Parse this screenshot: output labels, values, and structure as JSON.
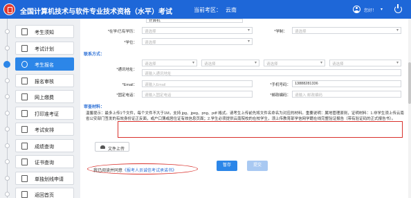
{
  "header": {
    "title": "全国计算机技术与软件专业技术资格（水平）考试",
    "region_label": "当前考区：",
    "region_value": "云南",
    "user_name": "您好！"
  },
  "sidebar": {
    "items": [
      {
        "label": "考生须知",
        "icon": "doc-icon"
      },
      {
        "label": "考试计划",
        "icon": "list-icon"
      },
      {
        "label": "考生报名",
        "icon": "clock-icon",
        "active": true
      },
      {
        "label": "报名审核",
        "icon": "review-icon"
      },
      {
        "label": "网上缴费",
        "icon": "card-icon"
      },
      {
        "label": "打印准考证",
        "icon": "printer-icon"
      },
      {
        "label": "考试安排",
        "icon": "schedule-icon"
      },
      {
        "label": "成绩查询",
        "icon": "search-icon"
      },
      {
        "label": "证书查询",
        "icon": "certificate-icon"
      },
      {
        "label": "单独划线申请",
        "icon": "apply-icon"
      },
      {
        "label": "返回首页",
        "icon": "home-icon"
      }
    ]
  },
  "form": {
    "top_field_value": "计算机",
    "education_label": "*在学/已有学历：",
    "education_value": "请选择",
    "degree_label": "*学制：",
    "degree_value": "请选择",
    "xuewei_label": "*学位：",
    "xuewei_value": "请选择",
    "contact_section": "联系方式：",
    "address_label": "*通讯地址：",
    "address_selects": [
      "请选择",
      "请选择",
      "请选择",
      "请选择"
    ],
    "address_placeholder": "请输入通讯地址",
    "email_label": "*Email：",
    "email_placeholder": "请输入Email",
    "mobile_label": "*手机号码：",
    "mobile_value": "13888281336",
    "phone_label": "*固定电话：",
    "phone_placeholder": "请输入固定电话",
    "postcode_label": "*邮政编码：",
    "postcode_placeholder": "请输入 邮政编码",
    "materials_section": "审查材料："
  },
  "notice": {
    "text": "温馨提示：最多上传1个文件，每个文件不大于1M，支持 jpg、jpeg、png、pdf 格式。请考生上传前先将文件名命名为对应的材料。重要说明：属地管理原则，证明材料：1.非学生须上传云南省公安部门签发的有效身份证正反面，或户口簿或居住证有效信息页面；2.学生必须提供云南院校的在校学生，须上传教育部学信网学籍在线完整验证报告（带有验证码的正式报告书）。"
  },
  "upload": {
    "label": "文件上传"
  },
  "agreement": {
    "prefix": "我已阅读并同意",
    "link": "《报考人员诚信考试承诺书》"
  },
  "buttons": {
    "save": "暂存",
    "submit": "提交"
  },
  "colors": {
    "header": "#1e67d8",
    "accent": "#2c86e8",
    "highlight": "#d9302b"
  }
}
